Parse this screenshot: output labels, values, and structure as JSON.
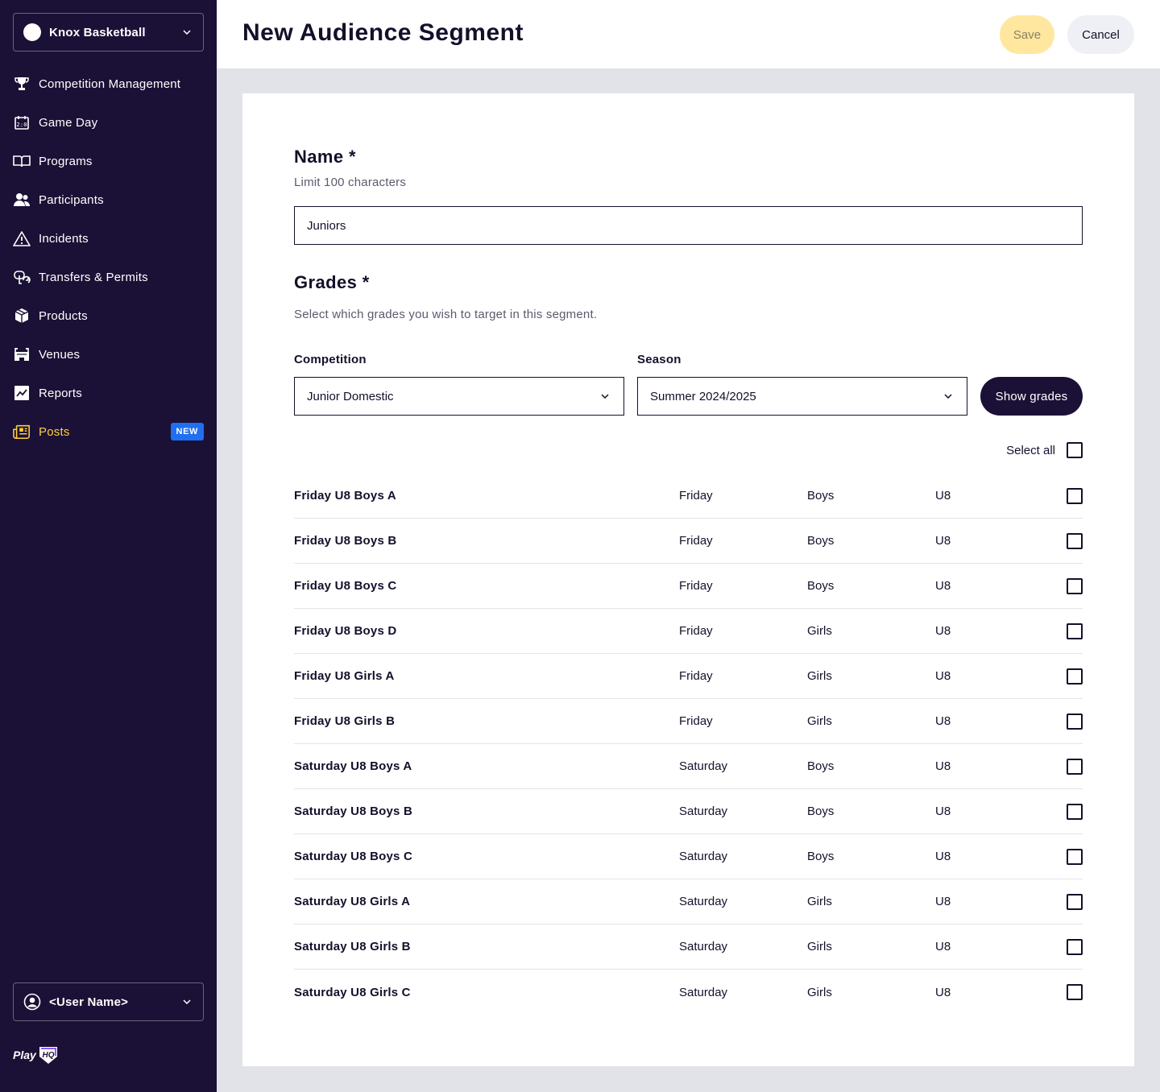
{
  "sidebar": {
    "org_name": "Knox Basketball",
    "items": [
      {
        "label": "Competition Management",
        "icon": "trophy-icon"
      },
      {
        "label": "Game Day",
        "icon": "scoreboard-icon"
      },
      {
        "label": "Programs",
        "icon": "book-icon"
      },
      {
        "label": "Participants",
        "icon": "people-icon"
      },
      {
        "label": "Incidents",
        "icon": "warning-icon"
      },
      {
        "label": "Transfers & Permits",
        "icon": "transfer-icon"
      },
      {
        "label": "Products",
        "icon": "box-icon"
      },
      {
        "label": "Venues",
        "icon": "stadium-icon"
      },
      {
        "label": "Reports",
        "icon": "chart-icon"
      },
      {
        "label": "Posts",
        "icon": "newspaper-icon",
        "badge": "NEW",
        "active": true
      }
    ],
    "user_name": "<User Name>",
    "logo_text": "Play",
    "logo_hq": "HQ"
  },
  "header": {
    "title": "New Audience Segment",
    "save_label": "Save",
    "cancel_label": "Cancel"
  },
  "form": {
    "name_title": "Name *",
    "name_hint": "Limit 100 characters",
    "name_value": "Juniors",
    "grades_title": "Grades *",
    "grades_hint": "Select which grades you wish to target in this segment.",
    "competition_label": "Competition",
    "competition_value": "Junior Domestic",
    "season_label": "Season",
    "season_value": "Summer 2024/2025",
    "show_grades_label": "Show grades",
    "select_all_label": "Select all"
  },
  "grades": [
    {
      "name": "Friday U8 Boys A",
      "day": "Friday",
      "gender": "Boys",
      "age": "U8"
    },
    {
      "name": "Friday U8 Boys B",
      "day": "Friday",
      "gender": "Boys",
      "age": "U8"
    },
    {
      "name": "Friday U8 Boys C",
      "day": "Friday",
      "gender": "Boys",
      "age": "U8"
    },
    {
      "name": "Friday U8 Boys D",
      "day": "Friday",
      "gender": "Girls",
      "age": "U8"
    },
    {
      "name": "Friday U8 Girls A",
      "day": "Friday",
      "gender": "Girls",
      "age": "U8"
    },
    {
      "name": "Friday U8 Girls B",
      "day": "Friday",
      "gender": "Girls",
      "age": "U8"
    },
    {
      "name": "Saturday U8 Boys A",
      "day": "Saturday",
      "gender": "Boys",
      "age": "U8"
    },
    {
      "name": "Saturday U8 Boys B",
      "day": "Saturday",
      "gender": "Boys",
      "age": "U8"
    },
    {
      "name": "Saturday U8 Boys C",
      "day": "Saturday",
      "gender": "Boys",
      "age": "U8"
    },
    {
      "name": "Saturday U8 Girls A",
      "day": "Saturday",
      "gender": "Girls",
      "age": "U8"
    },
    {
      "name": "Saturday U8 Girls B",
      "day": "Saturday",
      "gender": "Girls",
      "age": "U8"
    },
    {
      "name": "Saturday U8 Girls C",
      "day": "Saturday",
      "gender": "Girls",
      "age": "U8"
    }
  ],
  "colors": {
    "sidebar_bg": "#1b1136",
    "active_accent": "#ffcf3d",
    "badge_blue": "#1f6ff0",
    "save_disabled": "#ffe7a0"
  }
}
